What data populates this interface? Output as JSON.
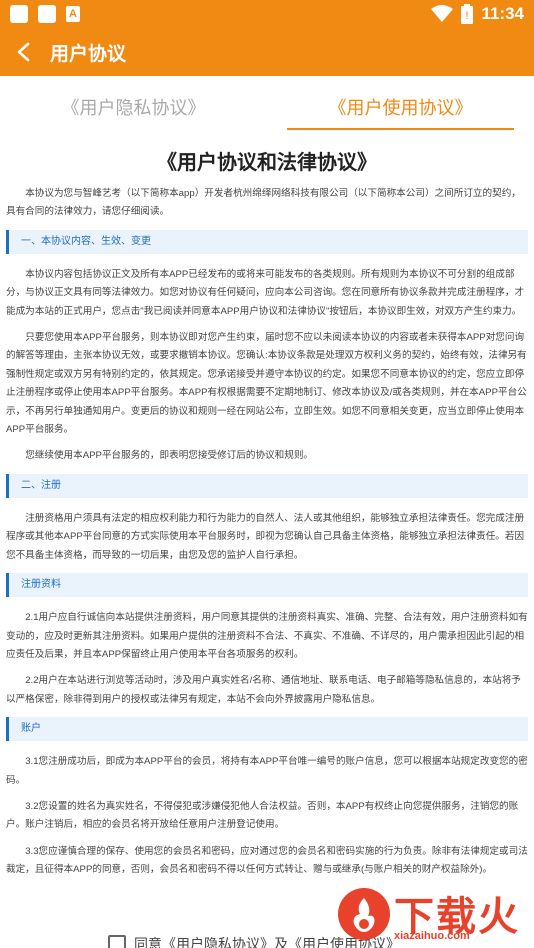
{
  "status_bar": {
    "time": "11:34",
    "notification_icon_letter": "A",
    "icons": [
      "notification-square-icon",
      "notification-square-icon",
      "font-app-icon",
      "wifi-icon",
      "battery-icon"
    ]
  },
  "app_bar": {
    "title": "用户协议"
  },
  "tabs": [
    {
      "label": "《用户隐私协议》",
      "active": false
    },
    {
      "label": "《用户使用协议》",
      "active": true
    }
  ],
  "document": {
    "title": "《用户协议和法律协议》",
    "intro": "本协议为您与智峰艺考（以下简称本app）开发者杭州绵绎网络科技有限公司（以下简称本公司）之间所订立的契约，具有合同的法律效力，请您仔细阅读。",
    "sections": [
      {
        "heading": "一、本协议内容、生效、变更",
        "paragraphs": [
          "本协议内容包括协议正文及所有本APP已经发布的或将来可能发布的各类规则。所有规则为本协议不可分割的组成部分，与协议正文具有同等法律效力。如您对协议有任何疑问，应向本公司咨询。您在同意所有协议条款并完成注册程序，才能成为本站的正式用户，您点击\"我已阅读并同意本APP用户协议和法律协议\"按钮后，本协议即生效，对双方产生约束力。",
          "只要您使用本APP平台服务，则本协议即对您产生约束，届时您不应以未阅读本协议的内容或者未获得本APP对您问询的解答等理由，主张本协议无效，或要求撤销本协议。您确认:本协议条款是处理双方权利义务的契约，始终有效，法律另有强制性规定或双方另有特别约定的，依其规定。您承诺接受并遵守本协议的约定。如果您不同意本协议的约定，您应立即停止注册程序或停止使用本APP平台服务。本APP有权根据需要不定期地制订、修改本协议及/或各类规则，并在本APP平台公示，不再另行单独通知用户。变更后的协议和规则一经在网站公布，立即生效。如您不同意相关变更，应当立即停止使用本APP平台服务。",
          "您继续使用本APP平台服务的，即表明您接受修订后的协议和规则。"
        ]
      },
      {
        "heading": "二、注册",
        "paragraphs": [
          "注册资格用户须具有法定的相应权利能力和行为能力的自然人、法人或其他组织，能够独立承担法律责任。您完成注册程序或其他本APP平台同意的方式实际使用本平台服务时，即视为您确认自己具备主体资格，能够独立承担法律责任。若因您不具备主体资格，而导致的一切后果，由您及您的监护人自行承担。"
        ]
      },
      {
        "heading": "注册资料",
        "paragraphs": [
          "2.1用户应自行诚信向本站提供注册资料，用户同意其提供的注册资料真实、准确、完整、合法有效，用户注册资料如有变动的，应及时更新其注册资料。如果用户提供的注册资料不合法、不真实、不准确、不详尽的，用户需承担因此引起的相应责任及后果，并且本APP保留终止用户使用本平台各项服务的权利。",
          "2.2用户在本站进行浏览等活动时，涉及用户真实姓名/名称、通信地址、联系电话、电子邮箱等隐私信息的，本站将予以严格保密，除非得到用户的授权或法律另有规定，本站不会向外界披露用户隐私信息。"
        ]
      },
      {
        "heading": "账户",
        "paragraphs": [
          "3.1您注册成功后，即成为本APP平台的会员，将持有本APP平台唯一编号的账户信息，您可以根据本站规定改变您的密码。",
          "3.2您设置的姓名为真实姓名，不得侵犯或涉嫌侵犯他人合法权益。否则，本APP有权终止向您提供服务，注销您的账户。账户注销后，相应的会员名将开放给任意用户注册登记使用。",
          "3.3您应谨慎合理的保存、使用您的会员名和密码，应对通过您的会员名和密码实施的行为负责。除非有法律规定或司法裁定，且征得本APP的同意，否则，会员名和密码不得以任何方式转让、赠与或继承(与账户相关的财产权益除外)。"
        ]
      }
    ]
  },
  "agreement": {
    "label": "同意《用户隐私协议》及《用户使用协议》",
    "checked": false
  },
  "watermark": {
    "big_text": "下载火",
    "small_text": "xiazaihuo.com"
  },
  "colors": {
    "brand": "#f08a13",
    "section_accent": "#1f6fbd",
    "section_bg": "#eaf3fb",
    "watermark": "#e8422c"
  }
}
